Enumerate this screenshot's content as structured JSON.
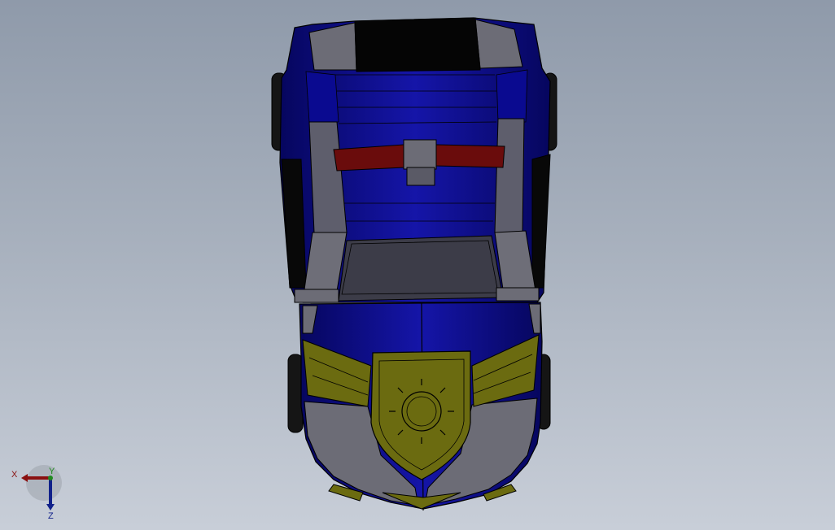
{
  "viewport": {
    "background_top": "#8f9aaa",
    "background_bottom": "#c8ced8"
  },
  "model": {
    "body_color": "#0c0c8c",
    "panel_color": "#6a6a74",
    "dark_color": "#0a0a0a",
    "badge_color": "#6b6b10",
    "strap_color": "#6e1010"
  },
  "triad": {
    "x_label": "X",
    "y_label": "Y",
    "z_label": "Z",
    "x_color": "#8a1010",
    "y_color": "#208a20",
    "z_color": "#10208a"
  }
}
